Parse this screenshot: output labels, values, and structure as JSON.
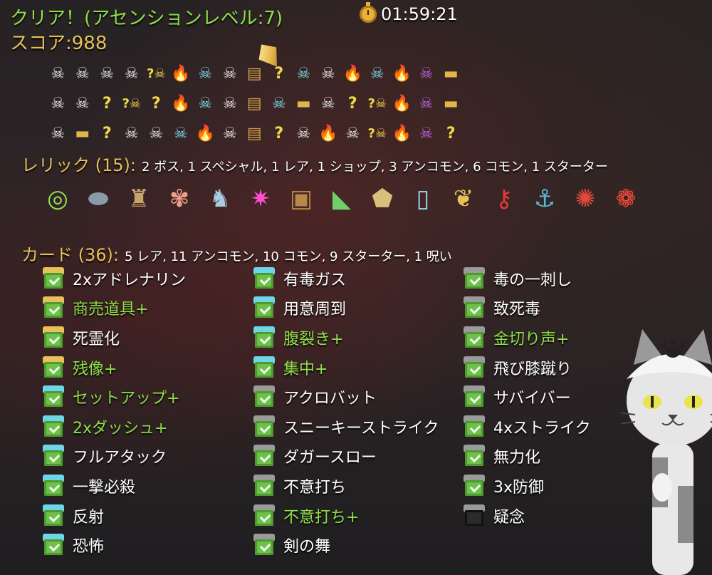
{
  "header": {
    "title": "クリア！(アセンションレベル:7)",
    "timer": "01:59:21",
    "score": "スコア:988"
  },
  "map": {
    "rows": [
      [
        "monster",
        "monster",
        "monster",
        "monster",
        "unknown-monster",
        "rest",
        "event",
        "monster",
        "chest",
        "unknown",
        "event",
        "monster",
        "rest",
        "event",
        "rest",
        "boss",
        "shop"
      ],
      [
        "monster",
        "monster",
        "unknown",
        "unknown-monster",
        "unknown",
        "rest",
        "event",
        "monster",
        "chest",
        "event",
        "shop",
        "monster",
        "unknown",
        "unknown-monster",
        "rest",
        "boss",
        "shop"
      ],
      [
        "monster",
        "shop",
        "unknown",
        "monster",
        "monster",
        "event",
        "rest",
        "monster",
        "chest",
        "unknown",
        "monster",
        "rest",
        "monster",
        "unknown-monster",
        "rest",
        "boss",
        "unknown"
      ]
    ]
  },
  "relics": {
    "label": "レリック (15):",
    "summary": "2 ボス, 1 スペシャル, 1 レア, 1 ショップ, 3 アンコモン, 6 コモン, 1 スターター",
    "items": [
      {
        "name": "ring-snake-relic-icon",
        "glyph": "◎",
        "color": "#8de05a"
      },
      {
        "name": "stone-relic-icon",
        "glyph": "⬬",
        "color": "#8a9aa6"
      },
      {
        "name": "totem-relic-icon",
        "glyph": "♜",
        "color": "#c9a46a"
      },
      {
        "name": "shrimp-relic-icon",
        "glyph": "✾",
        "color": "#ef9d8a"
      },
      {
        "name": "elephant-relic-icon",
        "glyph": "♞",
        "color": "#a8cce0"
      },
      {
        "name": "flame-relic-icon",
        "glyph": "✷",
        "color": "#ff4fd0"
      },
      {
        "name": "backpack-relic-icon",
        "glyph": "▣",
        "color": "#b8874a"
      },
      {
        "name": "shoe-relic-icon",
        "glyph": "◣",
        "color": "#6fd06a"
      },
      {
        "name": "pentagon-relic-icon",
        "glyph": "⬟",
        "color": "#d8c07a"
      },
      {
        "name": "mirror-relic-icon",
        "glyph": "▯",
        "color": "#9ad8f0"
      },
      {
        "name": "leaf-relic-icon",
        "glyph": "❦",
        "color": "#e8c15a"
      },
      {
        "name": "key-relic-icon",
        "glyph": "⚷",
        "color": "#e03a3a"
      },
      {
        "name": "cannon-relic-icon",
        "glyph": "⚓",
        "color": "#5ab8d8"
      },
      {
        "name": "claw-relic-icon",
        "glyph": "✺",
        "color": "#e04a3a"
      },
      {
        "name": "fish-relic-icon",
        "glyph": "❁",
        "color": "#ff4a3a"
      }
    ]
  },
  "cards": {
    "label": "カード (36):",
    "summary": "5 レア, 11 アンコモン, 10 コモン, 9 スターター, 1 呪い",
    "columns": [
      [
        {
          "name": "2xアドレナリン",
          "rarity": "rare",
          "upgraded": false
        },
        {
          "name": "商売道具+",
          "rarity": "rare",
          "upgraded": true
        },
        {
          "name": "死霊化",
          "rarity": "rare",
          "upgraded": false
        },
        {
          "name": "残像+",
          "rarity": "rare",
          "upgraded": true
        },
        {
          "name": "セットアップ+",
          "rarity": "unc",
          "upgraded": true
        },
        {
          "name": "2xダッシュ+",
          "rarity": "unc",
          "upgraded": true
        },
        {
          "name": "フルアタック",
          "rarity": "unc",
          "upgraded": false
        },
        {
          "name": "一撃必殺",
          "rarity": "unc",
          "upgraded": false
        },
        {
          "name": "反射",
          "rarity": "unc",
          "upgraded": false
        },
        {
          "name": "恐怖",
          "rarity": "unc",
          "upgraded": false
        }
      ],
      [
        {
          "name": "有毒ガス",
          "rarity": "unc",
          "upgraded": false
        },
        {
          "name": "用意周到",
          "rarity": "unc",
          "upgraded": false
        },
        {
          "name": "腹裂き+",
          "rarity": "unc",
          "upgraded": true
        },
        {
          "name": "集中+",
          "rarity": "unc",
          "upgraded": true
        },
        {
          "name": "アクロバット",
          "rarity": "com",
          "upgraded": false
        },
        {
          "name": "スニーキーストライク",
          "rarity": "com",
          "upgraded": false
        },
        {
          "name": "ダガースロー",
          "rarity": "com",
          "upgraded": false
        },
        {
          "name": "不意打ち",
          "rarity": "com",
          "upgraded": false
        },
        {
          "name": "不意打ち+",
          "rarity": "com",
          "upgraded": true
        },
        {
          "name": "剣の舞",
          "rarity": "com",
          "upgraded": false
        }
      ],
      [
        {
          "name": "毒の一刺し",
          "rarity": "com",
          "upgraded": false
        },
        {
          "name": "致死毒",
          "rarity": "com",
          "upgraded": false
        },
        {
          "name": "金切り声+",
          "rarity": "com",
          "upgraded": true
        },
        {
          "name": "飛び膝蹴り",
          "rarity": "com",
          "upgraded": false
        },
        {
          "name": "サバイバー",
          "rarity": "start",
          "upgraded": false
        },
        {
          "name": "4xストライク",
          "rarity": "start",
          "upgraded": false
        },
        {
          "name": "無力化",
          "rarity": "start",
          "upgraded": false
        },
        {
          "name": "3x防御",
          "rarity": "start",
          "upgraded": false
        },
        {
          "name": "疑念",
          "rarity": "curse",
          "upgraded": false
        }
      ]
    ]
  },
  "colors": {
    "title_green": "#8ee04a",
    "gold": "#e8c15a",
    "upgraded": "#8ee04a"
  }
}
